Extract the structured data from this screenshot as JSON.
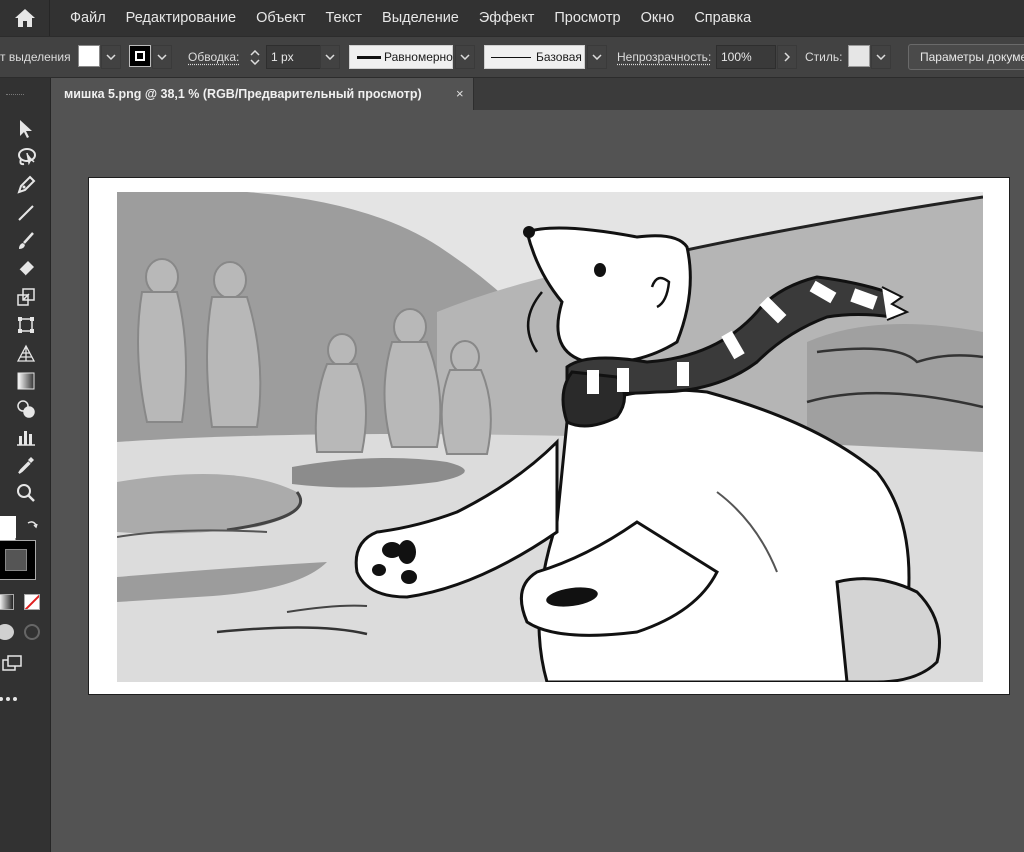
{
  "menu": {
    "items": [
      "Файл",
      "Редактирование",
      "Объект",
      "Текст",
      "Выделение",
      "Эффект",
      "Просмотр",
      "Окно",
      "Справка"
    ]
  },
  "control": {
    "selection_label": "т выделения",
    "stroke_label": "Обводка:",
    "stroke_value": "1 px",
    "profile_label": "Равномерно",
    "brush_label": "Базовая",
    "opacity_label": "Непрозрачность:",
    "opacity_value": "100%",
    "style_label": "Стиль:",
    "doc_settings_label": "Параметры документа"
  },
  "document": {
    "tab_title": "мишка 5.png @ 38,1 % (RGB/Предварительный просмотр)",
    "close_glyph": "×"
  },
  "colors": {
    "fill": "#ffffff",
    "stroke": "#000000",
    "style_swatch": "#e6e6e6"
  },
  "icons": [
    "home-icon",
    "selection-tool-icon",
    "lasso-tool-icon",
    "pen-tool-icon",
    "line-tool-icon",
    "brush-tool-icon",
    "eraser-tool-icon",
    "scale-tool-icon",
    "free-transform-tool-icon",
    "perspective-grid-icon",
    "gradient-tool-icon",
    "shape-builder-icon",
    "graph-tool-icon",
    "eyedropper-tool-icon",
    "zoom-tool-icon",
    "swap-colors-icon",
    "more-tools-icon"
  ]
}
